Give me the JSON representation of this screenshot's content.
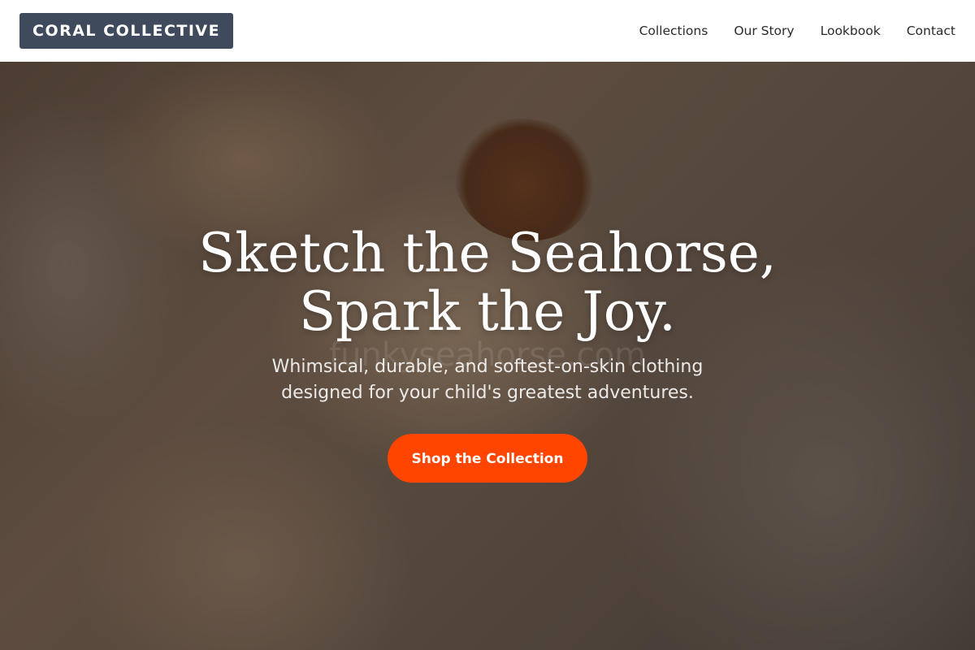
{
  "brand": {
    "logo_text": "CORAL COLLECTIVE"
  },
  "nav": {
    "items": [
      {
        "label": "Collections"
      },
      {
        "label": "Our Story"
      },
      {
        "label": "Lookbook"
      },
      {
        "label": "Contact"
      }
    ]
  },
  "hero": {
    "headline_line1": "Sketch the Seahorse,",
    "headline_line2": "Spark the Joy.",
    "watermark": "funkyseahorse.com",
    "subhead_line1": "Whimsical, durable, and softest-on-skin clothing",
    "subhead_line2": "designed for your child's greatest adventures.",
    "cta_label": "Shop the Collection"
  },
  "colors": {
    "logo_bg": "#3f4a5c",
    "cta_bg": "#ff4500",
    "nav_text": "#2b2b2b"
  }
}
